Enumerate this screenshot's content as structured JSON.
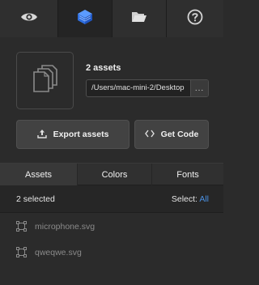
{
  "toolbar": {
    "tabs": [
      {
        "icon": "eye-icon"
      },
      {
        "icon": "layers-box-icon",
        "active": true
      },
      {
        "icon": "folder-open-icon"
      },
      {
        "icon": "help-circle-icon"
      }
    ]
  },
  "summary": {
    "thumb_icon": "copy-documents-icon",
    "count_label": "2 assets",
    "path_value": "/Users/mac-mini-2/Desktop",
    "browse_label": "..."
  },
  "actions": {
    "export_label": "Export assets",
    "get_code_label": "Get Code"
  },
  "section_tabs": [
    {
      "label": "Assets",
      "active": true
    },
    {
      "label": "Colors"
    },
    {
      "label": "Fonts"
    }
  ],
  "selection": {
    "selected_text": "2 selected",
    "select_prefix": "Select:",
    "select_all_link": "All"
  },
  "assets": [
    {
      "name": "microphone.svg"
    },
    {
      "name": "qweqwe.svg"
    }
  ],
  "colors": {
    "accent": "#4a90e2",
    "active_icon": "#3b7ff0"
  }
}
